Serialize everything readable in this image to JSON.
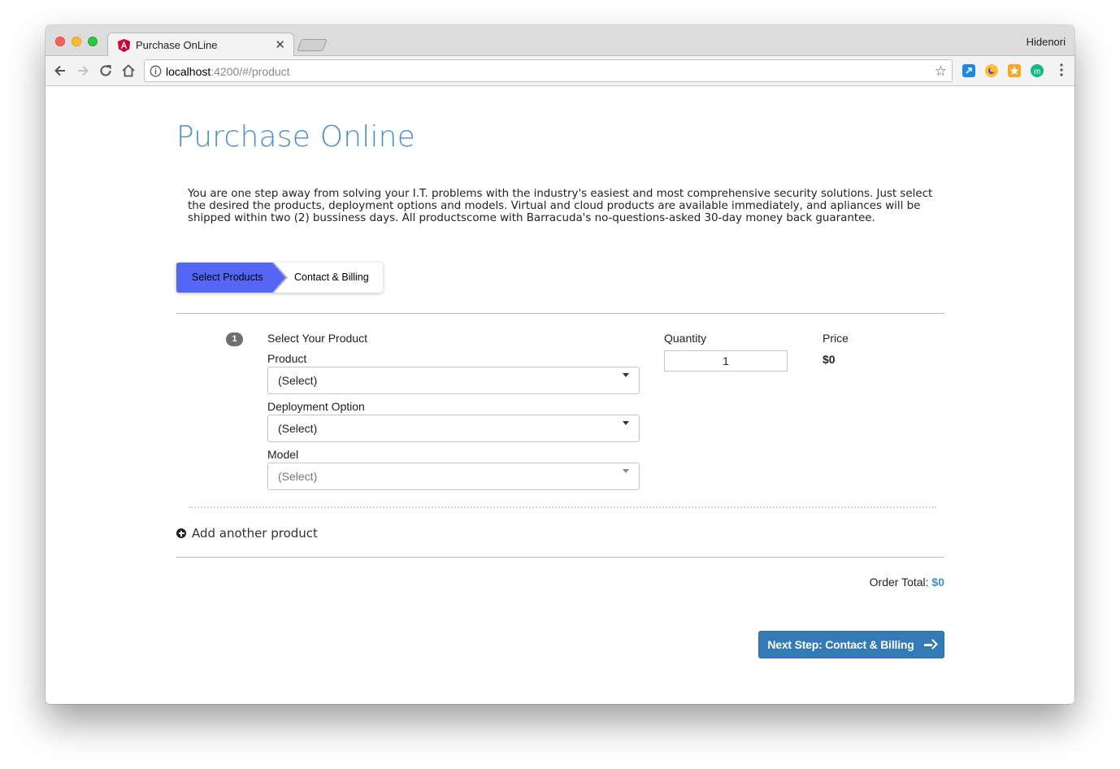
{
  "browser": {
    "tab_title": "Purchase OnLine",
    "profile_name": "Hidenori",
    "url_host": "localhost",
    "url_rest": ":4200/#/product"
  },
  "page": {
    "title": "Purchase Online",
    "intro": "You are one step away from solving your I.T. problems with the industry's easiest and most comprehensive security solutions. Just select the desired the products, deployment options and models. Virtual and cloud products are available immediately, and apliances will be shipped within two (2) bussiness days. All productscome with Barracuda's no-questions-asked 30-day money back guarantee."
  },
  "steps": [
    {
      "label": "Select Products",
      "active": true
    },
    {
      "label": "Contact & Billing",
      "active": false
    }
  ],
  "product_row": {
    "number": "1",
    "heading": "Select Your Product",
    "product_label": "Product",
    "product_value": "(Select)",
    "deployment_label": "Deployment Option",
    "deployment_value": "(Select)",
    "model_label": "Model",
    "model_value": "(Select)",
    "quantity_label": "Quantity",
    "quantity_value": "1",
    "price_label": "Price",
    "price_value": "$0"
  },
  "add_product_label": "Add another product",
  "order_total": {
    "label": "Order Total:",
    "amount": "$0"
  },
  "next_button_label": "Next Step: Contact & Billing",
  "colors": {
    "accent_title": "#4a8fcf",
    "step_active": "#5566f5",
    "primary_button": "#337ab7",
    "total_amount": "#3b8fd6"
  }
}
